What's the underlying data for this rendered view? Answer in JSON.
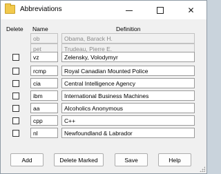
{
  "window": {
    "title": "Abbreviations"
  },
  "headers": {
    "delete": "Delete",
    "name": "Name",
    "definition": "Definition"
  },
  "readonly_rows": [
    {
      "name": "ob",
      "definition": "Obama, Barack H."
    },
    {
      "name": "pet",
      "definition": "Trudeau, Pierre E."
    }
  ],
  "rows": [
    {
      "checked": false,
      "name": "vz",
      "definition": "Zelensky, Volodymyr"
    },
    {
      "checked": false,
      "name": "rcmp",
      "definition": "Royal Canadian Mounted Police"
    },
    {
      "checked": false,
      "name": "cia",
      "definition": "Central Intelligence Agency"
    },
    {
      "checked": false,
      "name": "ibm",
      "definition": "International Business Machines"
    },
    {
      "checked": false,
      "name": "aa",
      "definition": "Alcoholics Anonymous"
    },
    {
      "checked": false,
      "name": "cpp",
      "definition": "C++"
    },
    {
      "checked": false,
      "name": "nl",
      "definition": "Newfoundland & Labrador"
    }
  ],
  "buttons": {
    "add": "Add",
    "delete_marked": "Delete Marked",
    "save": "Save",
    "help": "Help"
  },
  "title_controls": {
    "minimize": "minimize-icon",
    "maximize": "maximize-icon",
    "close": "close-icon"
  }
}
